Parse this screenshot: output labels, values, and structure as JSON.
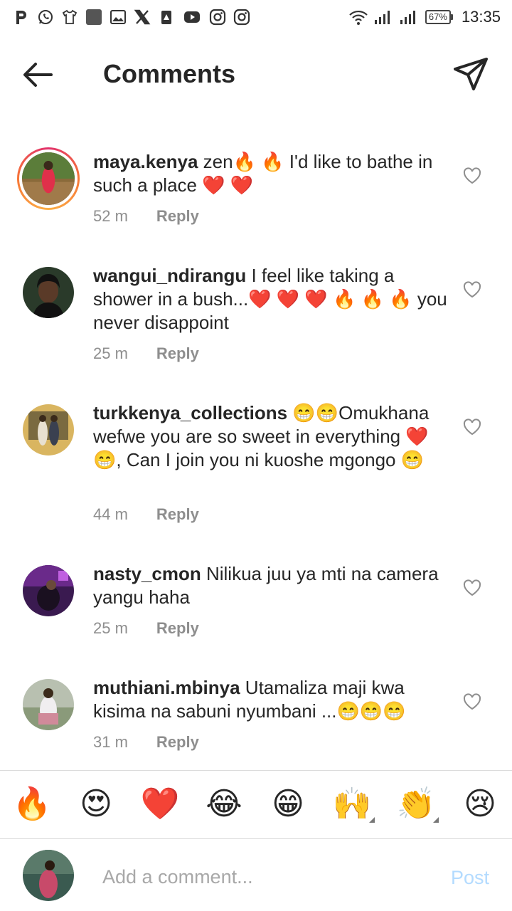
{
  "status_bar": {
    "battery": "67%",
    "time": "13:35",
    "left_icons": [
      "pinterest-icon",
      "whatsapp-icon",
      "shirt-icon",
      "app-square-icon",
      "gallery-icon",
      "x-icon",
      "warning-icon",
      "youtube-icon",
      "instagram-icon",
      "instagram-icon"
    ]
  },
  "header": {
    "title": "Comments"
  },
  "comments": [
    {
      "username": "maya.kenya",
      "text": " zen🔥 🔥 I'd like to bathe in such a place ❤️ ❤️",
      "time": "52 m",
      "reply": "Reply"
    },
    {
      "username": "wangui_ndirangu",
      "text": " I feel like taking a shower in a bush...❤️ ❤️ ❤️ 🔥 🔥 🔥 you never disappoint",
      "time": "25 m",
      "reply": "Reply"
    },
    {
      "username": "turkkenya_collections",
      "text": " 😁😁Omukhana wefwe you are so sweet in everything ❤️😁, Can I join you  ni kuoshe mgongo 😁",
      "time": "44 m",
      "reply": "Reply"
    },
    {
      "username": "nasty_cmon",
      "text": " Nilikua juu ya mti na camera yangu haha",
      "time": "25 m",
      "reply": "Reply"
    },
    {
      "username": "muthiani.mbinya",
      "text": " Utamaliza maji kwa kisima na sabuni nyumbani ...😁😁😁",
      "time": "31 m",
      "reply": "Reply"
    }
  ],
  "emoji_bar": [
    "🔥",
    "😍",
    "❤️",
    "😂",
    "😁",
    "🙌",
    "👏",
    "😢"
  ],
  "composer": {
    "placeholder": "Add a comment...",
    "post_label": "Post"
  },
  "colors": {
    "text": "#262626",
    "secondary": "#8e8e8e",
    "post_disabled": "#b3dbff",
    "story_ring": "#e1306c"
  }
}
